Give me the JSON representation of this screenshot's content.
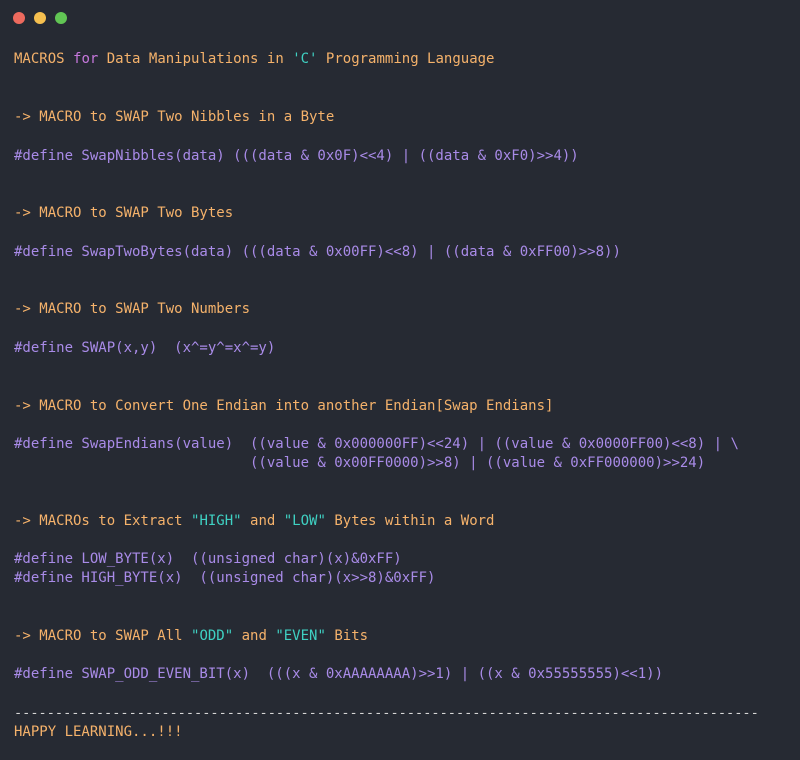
{
  "window": {
    "controls": {
      "close_color": "#ed6a5e",
      "minimize_color": "#f5bf4f",
      "zoom_color": "#61c554"
    }
  },
  "title": {
    "part1": "MACROS ",
    "kw": "for",
    "part2": " Data Manipulations in ",
    "str": "'C'",
    "part3": " Programming Language"
  },
  "sections": {
    "nibbles": {
      "arrow": "->",
      "heading": " MACRO to SWAP Two Nibbles in a Byte",
      "code": "#define SwapNibbles(data) (((data & 0x0F)<<4) | ((data & 0xF0)>>4))"
    },
    "bytes": {
      "arrow": "->",
      "heading": " MACRO to SWAP Two Bytes",
      "code": "#define SwapTwoBytes(data) (((data & 0x00FF)<<8) | ((data & 0xFF00)>>8))"
    },
    "numbers": {
      "arrow": "->",
      "heading": " MACRO to SWAP Two Numbers",
      "code": "#define SWAP(x,y)  (x^=y^=x^=y)"
    },
    "endian": {
      "arrow": "->",
      "heading": " MACRO to Convert One Endian into another Endian[Swap Endians]",
      "code1": "#define SwapEndians(value)  ((value & 0x000000FF)<<24) | ((value & 0x0000FF00)<<8) | \\",
      "code2": "                            ((value & 0x00FF0000)>>8) | ((value & 0xFF000000)>>24)"
    },
    "extract": {
      "arrow": "->",
      "heading_a": " MACROs to Extract ",
      "str_high": "\"HIGH\"",
      "heading_b": " and ",
      "str_low": "\"LOW\"",
      "heading_c": " Bytes within a Word",
      "code1": "#define LOW_BYTE(x)  ((unsigned char)(x)&0xFF)",
      "code2": "#define HIGH_BYTE(x)  ((unsigned char)(x>>8)&0xFF)"
    },
    "oddeven": {
      "arrow": "->",
      "heading_a": " MACRO to SWAP All ",
      "str_odd": "\"ODD\"",
      "heading_b": " and ",
      "str_even": "\"EVEN\"",
      "heading_c": " Bits",
      "code": "#define SWAP_ODD_EVEN_BIT(x)  (((x & 0xAAAAAAAA)>>1) | ((x & 0x55555555)<<1))"
    }
  },
  "footer": {
    "separator": "-------------------------------------------------------------------------------------------",
    "message": "HAPPY LEARNING...!!!"
  }
}
